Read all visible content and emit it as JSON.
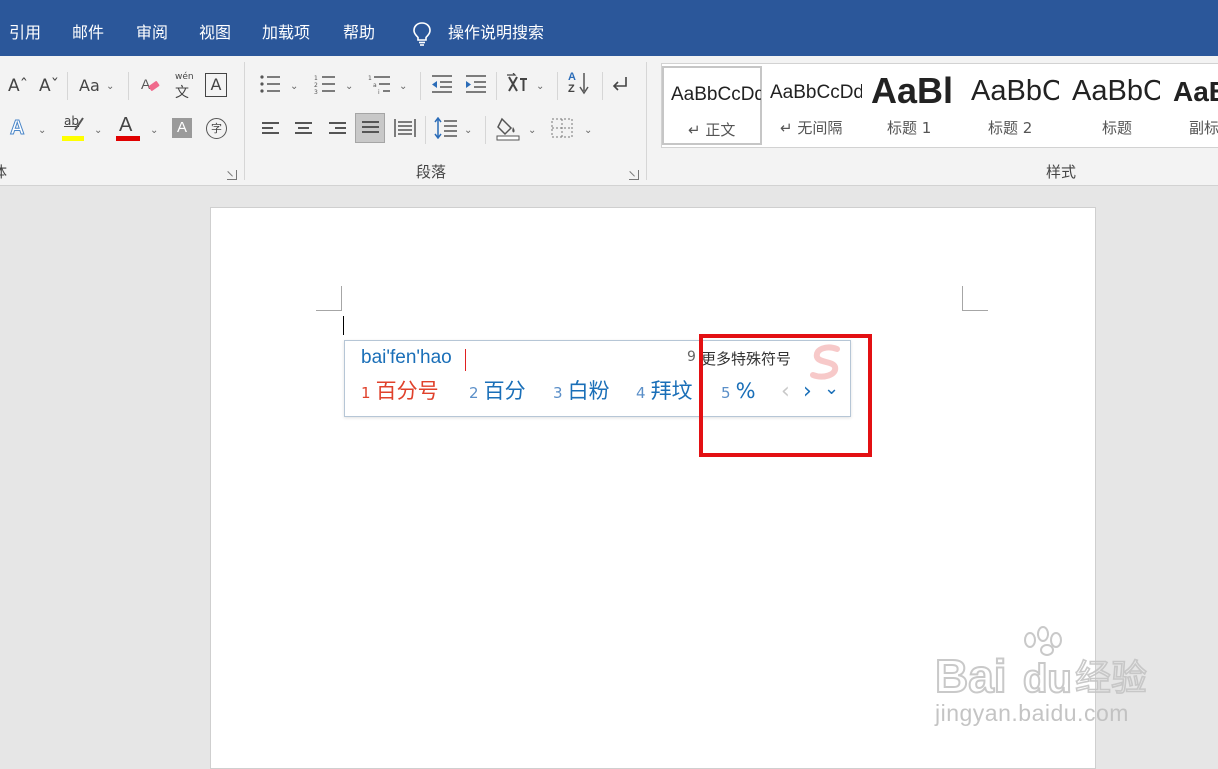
{
  "menubar": {
    "items": [
      "引用",
      "邮件",
      "审阅",
      "视图",
      "加载项",
      "帮助"
    ],
    "tell_me": "操作说明搜索"
  },
  "ribbon": {
    "font_group": {
      "partial_label": "体",
      "change_case_label": "Aa",
      "phonetic_small": "wén",
      "phonetic_big": "文",
      "char_border_label": "A",
      "text_effects_label": "A",
      "highlight_label": "ab",
      "font_color_label": "A",
      "char_shading_label": "A",
      "enclose_label": "字",
      "highlight_color": "#ffff00",
      "font_color": "#e00000"
    },
    "paragraph_group": {
      "label": "段落",
      "sort_label_a": "A",
      "sort_label_z": "Z"
    },
    "styles_group": {
      "label": "样式",
      "items": [
        {
          "preview": "AaBbCcDd",
          "name": "↵ 正文"
        },
        {
          "preview": "AaBbCcDd",
          "name": "↵ 无间隔"
        },
        {
          "preview": "AaBl",
          "name": "标题 1"
        },
        {
          "preview": "AaBbC",
          "name": "标题 2"
        },
        {
          "preview": "AaBbC",
          "name": "标题"
        },
        {
          "preview": "AaB",
          "name": "副标"
        }
      ]
    }
  },
  "ime": {
    "composition": "bai'fen'hao",
    "more_symbols_number": "9",
    "more_symbols_label": "更多特殊符号",
    "candidates": [
      {
        "num": "1",
        "text": "百分号"
      },
      {
        "num": "2",
        "text": "百分"
      },
      {
        "num": "3",
        "text": "白粉"
      },
      {
        "num": "4",
        "text": "拜坟"
      },
      {
        "num": "5",
        "text": "%"
      }
    ],
    "prev_glyph": "‹",
    "next_glyph": "›",
    "expand_glyph": "⌄",
    "first_candidate_color": "#e0412b",
    "candidate_color": "#1a6fb8"
  },
  "colors": {
    "title_bar": "#2b579a",
    "highlight_box": "#e31013"
  },
  "watermark": {
    "logo_text_a": "Bai",
    "logo_text_b": "du",
    "logo_text_c": "经验",
    "url": "jingyan.baidu.com"
  }
}
